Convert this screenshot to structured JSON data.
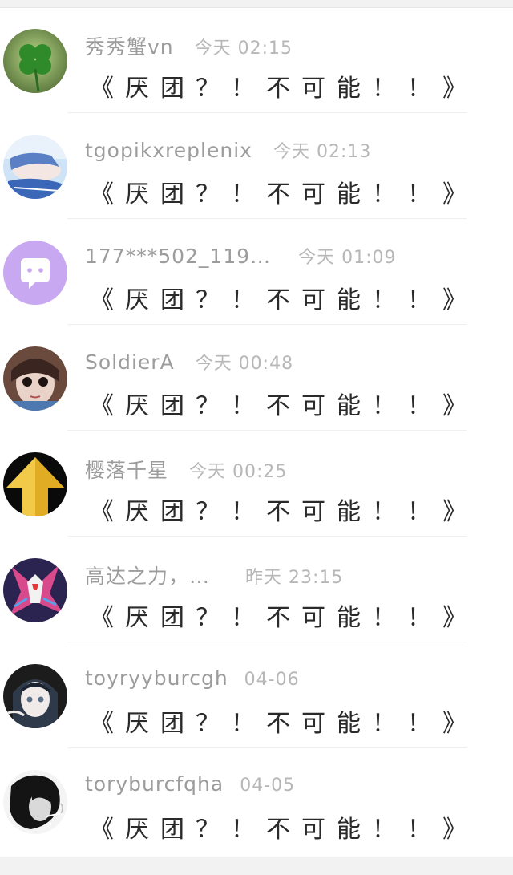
{
  "comments": [
    {
      "username": "秀秀蟹vn",
      "time": "今天 02:15",
      "text": "《厌团？！不可能！！》"
    },
    {
      "username": "tgopikxreplenix",
      "time": "今天 02:13",
      "text": "《厌团？！不可能！！》"
    },
    {
      "username": "177***502_119…",
      "time": "今天 01:09",
      "text": "《厌团？！不可能！！》"
    },
    {
      "username": "SoldierA",
      "time": "今天 00:48",
      "text": "《厌团？！不可能！！》"
    },
    {
      "username": "樱落千星",
      "time": "今天 00:25",
      "text": "《厌团？！不可能！！》"
    },
    {
      "username": "高达之力，…",
      "time": "昨天 23:15",
      "text": "《厌团？！不可能！！》"
    },
    {
      "username": "toyryyburcgh",
      "time": "04-06",
      "text": "《厌团？！不可能！！》"
    },
    {
      "username": "toryburcfqha",
      "time": "04-05",
      "text": "《厌团？！不可能！！》"
    }
  ],
  "avatars": [
    "clover-icon",
    "anime-sleeping-icon",
    "chat-bubble-icon",
    "doll-face-icon",
    "up-arrow-icon",
    "gundam-icon",
    "anime-girl-icon",
    "smoking-person-icon"
  ],
  "colors": {
    "username": "#9c9c9c",
    "time": "#b7b7b7",
    "text": "#2a2a2a",
    "chat_avatar_bg": "#c9a8f2"
  }
}
